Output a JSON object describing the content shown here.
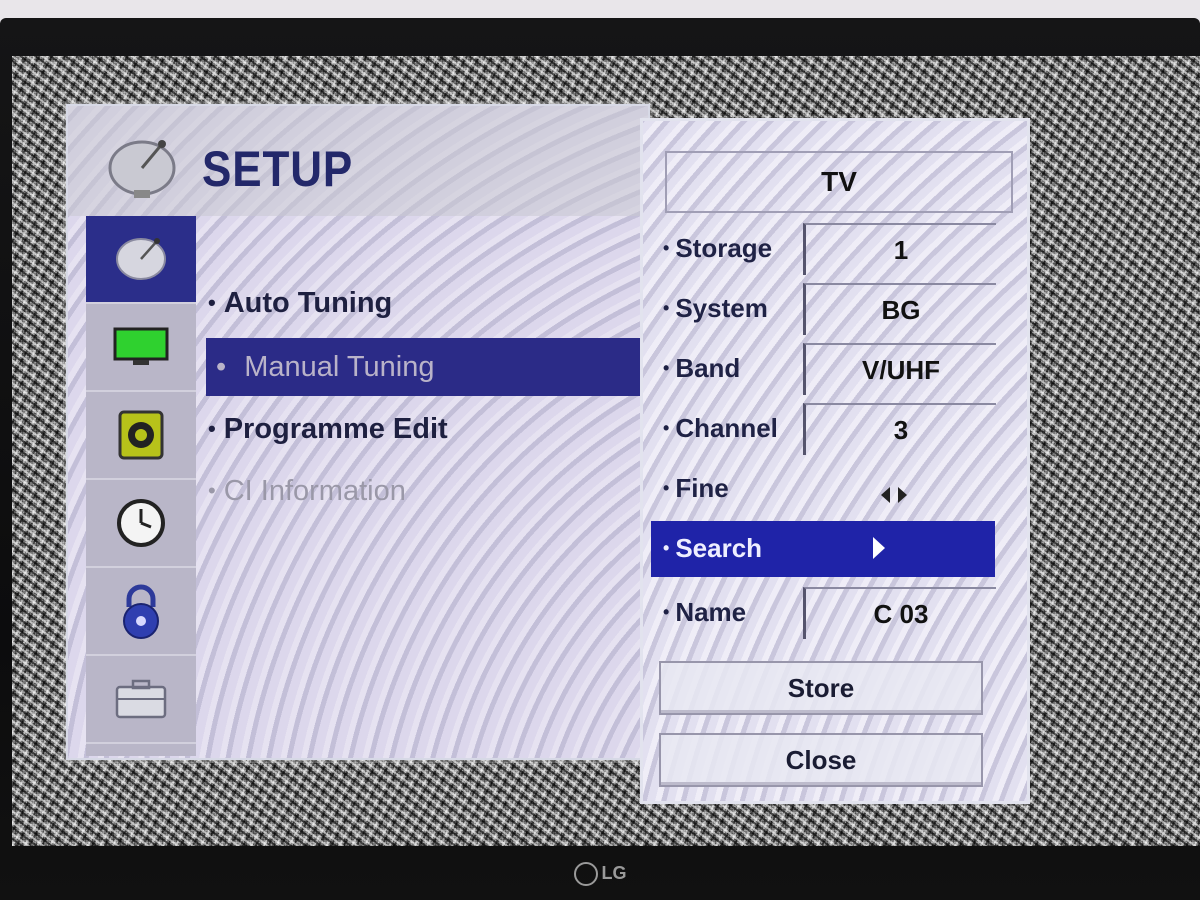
{
  "setup": {
    "title": "SETUP",
    "menu": [
      {
        "label": "Auto Tuning"
      },
      {
        "label": "Manual Tuning"
      },
      {
        "label": "Programme Edit"
      },
      {
        "label": "CI Information"
      }
    ],
    "sidebar_icons": [
      "satellite-dish-icon",
      "monitor-icon",
      "speaker-icon",
      "clock-icon",
      "lock-icon",
      "toolbox-icon"
    ]
  },
  "tuning": {
    "mode": "TV",
    "rows": {
      "storage": {
        "label": "Storage",
        "value": "1"
      },
      "system": {
        "label": "System",
        "value": "BG"
      },
      "band": {
        "label": "Band",
        "value": "V/UHF"
      },
      "channel": {
        "label": "Channel",
        "value": "3"
      },
      "fine": {
        "label": "Fine"
      },
      "search": {
        "label": "Search"
      },
      "name": {
        "label": "Name",
        "value": "C 03"
      }
    },
    "store_label": "Store",
    "close_label": "Close"
  },
  "brand": "LG",
  "colors": {
    "highlight": "#1f23a8",
    "menu_selected": "#2b2b87",
    "title": "#23286a"
  }
}
